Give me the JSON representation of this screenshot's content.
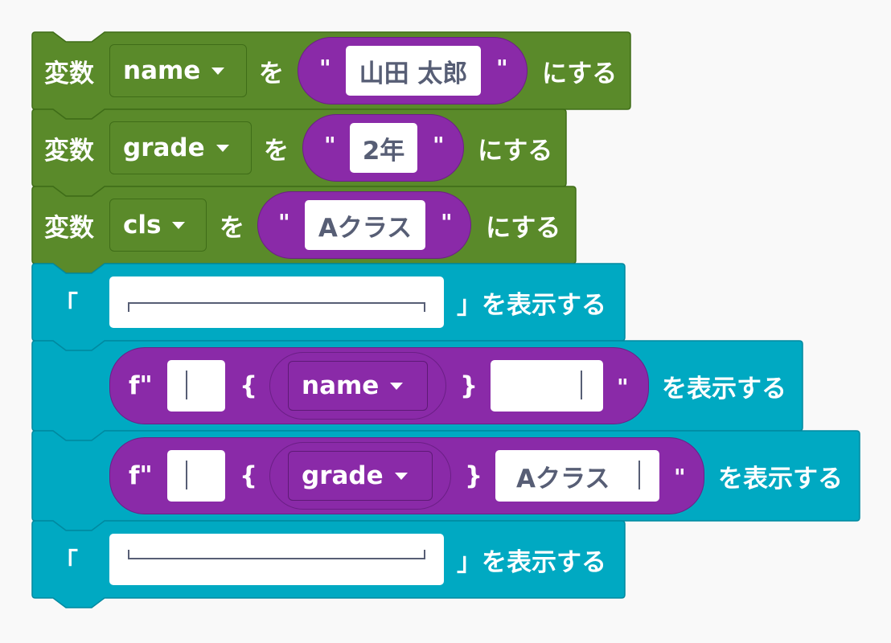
{
  "colors": {
    "variable_block": "#5a8a2a",
    "display_block": "#00a9c2",
    "string_reporter": "#8a2aa8",
    "field_text": "#575e75"
  },
  "blocks": [
    {
      "type": "set_variable",
      "prefix": "変数",
      "variable": "name",
      "connector": "を",
      "value": "山田 太郎",
      "suffix": "にする"
    },
    {
      "type": "set_variable",
      "prefix": "変数",
      "variable": "grade",
      "connector": "を",
      "value": "2年",
      "suffix": "にする"
    },
    {
      "type": "set_variable",
      "prefix": "変数",
      "variable": "cls",
      "connector": "を",
      "value": "Aクラス",
      "suffix": "にする"
    },
    {
      "type": "display_text",
      "open": "「",
      "value": "┌─────────────────┐",
      "close": "」を表示する"
    },
    {
      "type": "display_fstring",
      "prefix": "f\"",
      "pre": "",
      "variable": "name",
      "post": "",
      "suffix": "\"",
      "action": "を表示する"
    },
    {
      "type": "display_fstring",
      "prefix": "f\"",
      "pre": "",
      "variable": "grade",
      "post": "Aクラス",
      "suffix": "\"",
      "action": "を表示する"
    },
    {
      "type": "display_text",
      "open": "「",
      "value": "└─────────────────┘",
      "close": "」を表示する"
    }
  ],
  "symbols": {
    "quote": "\"",
    "brace_open": "{",
    "brace_close": "}"
  }
}
